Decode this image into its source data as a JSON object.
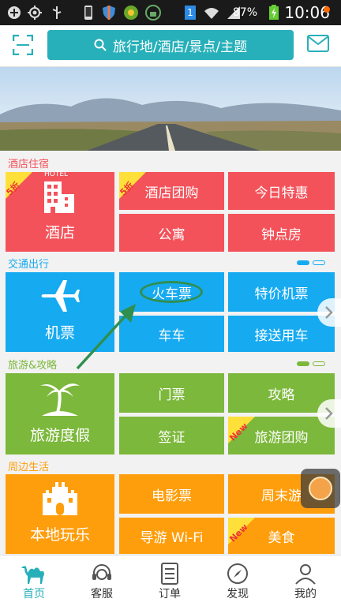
{
  "status_bar": {
    "battery": "87%",
    "time": "10:06",
    "notification_count": "1"
  },
  "header": {
    "search_placeholder": "旅行地/酒店/景点/主题"
  },
  "sections": {
    "hotel": {
      "title": "酒店住宿",
      "big_tile": "酒店",
      "hotel_badge": "HOTEL",
      "discount_badge": "5折",
      "tiles": [
        "酒店团购",
        "今日特惠",
        "公寓",
        "钟点房"
      ],
      "group_badge": "5折"
    },
    "transport": {
      "title": "交通出行",
      "big_tile": "机票",
      "tiles": [
        "火车票",
        "特价机票",
        "车车",
        "接送用车"
      ]
    },
    "travel": {
      "title": "旅游&攻略",
      "big_tile": "旅游度假",
      "tiles": [
        "门票",
        "攻略",
        "签证",
        "旅游团购"
      ],
      "new_badge": "New"
    },
    "local": {
      "title": "周边生活",
      "big_tile": "本地玩乐",
      "tiles": [
        "电影票",
        "周末游",
        "导游 Wi-Fi",
        "美食"
      ],
      "new_badge": "New"
    }
  },
  "tabbar": {
    "items": [
      "首页",
      "客服",
      "订单",
      "发现",
      "我的"
    ],
    "active": "首页"
  },
  "colors": {
    "accent": "#27b0b9",
    "hotel": "#f3525a",
    "transport": "#16aaf1",
    "travel": "#7cb83b",
    "local": "#ff9e0c"
  }
}
